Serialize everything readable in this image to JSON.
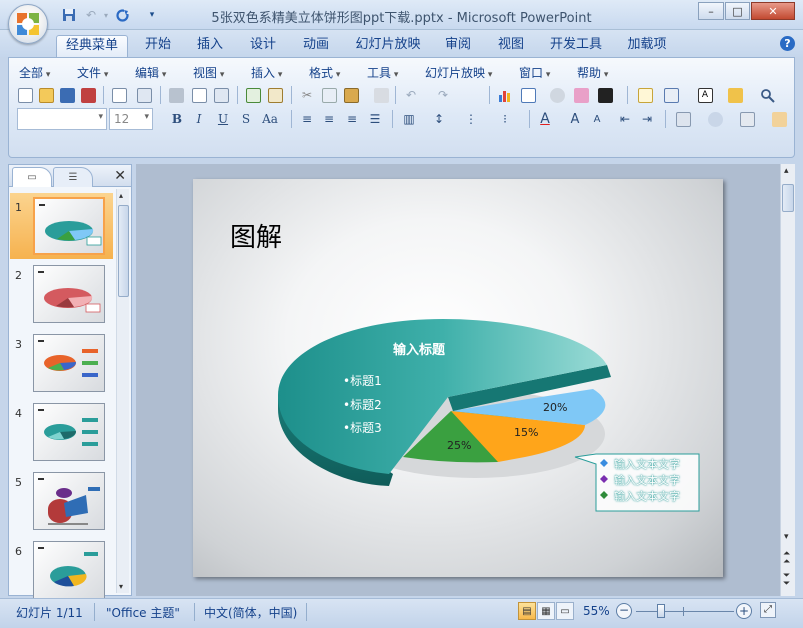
{
  "window": {
    "title": "5张双色系精美立体饼形图ppt下载.pptx - Microsoft PowerPoint",
    "controls": {
      "minimize": "–",
      "maximize": "□",
      "close": "✕"
    }
  },
  "qat": {
    "save": "save-icon",
    "undo": "undo-icon",
    "redo": "redo-icon",
    "customize": "▾"
  },
  "tabs": [
    {
      "label": "经典菜单",
      "active": true
    },
    {
      "label": "开始"
    },
    {
      "label": "插入"
    },
    {
      "label": "设计"
    },
    {
      "label": "动画"
    },
    {
      "label": "幻灯片放映"
    },
    {
      "label": "审阅"
    },
    {
      "label": "视图"
    },
    {
      "label": "开发工具"
    },
    {
      "label": "加载项"
    }
  ],
  "help": "?",
  "menus": [
    "全部",
    "文件",
    "编辑",
    "视图",
    "插入",
    "格式",
    "工具",
    "幻灯片放映",
    "窗口",
    "帮助"
  ],
  "format": {
    "font_value": "",
    "size_value": "12",
    "bold": "B",
    "italic": "I",
    "underline": "U",
    "shadow": "S",
    "case": "Aa",
    "font_color": "A"
  },
  "panel": {
    "close": "✕",
    "slides": [
      {
        "num": "1",
        "selected": true
      },
      {
        "num": "2"
      },
      {
        "num": "3"
      },
      {
        "num": "4"
      },
      {
        "num": "5"
      },
      {
        "num": "6"
      }
    ]
  },
  "slide": {
    "title": "图解",
    "pie_title": "输入标题",
    "bullets": [
      "•标题1",
      "•标题2",
      "•标题3"
    ],
    "labels": {
      "blue": "20%",
      "orange": "15%",
      "green": "25%"
    },
    "legend": [
      "输入文本文字",
      "输入文本文字",
      "输入文本文字"
    ],
    "colors": {
      "teal": "#2a9d9a",
      "blue": "#7fc8f6",
      "orange": "#ffa51a",
      "green": "#3aa040",
      "legend_blue": "#3a8de0",
      "legend_purple": "#7a2fb0",
      "legend_green": "#2e8b3a"
    }
  },
  "status": {
    "slide_info": "幻灯片 1/11",
    "theme": "\"Office 主题\"",
    "language": "中文(简体，中国)",
    "zoom": "55%",
    "zoom_level": 0.55
  }
}
